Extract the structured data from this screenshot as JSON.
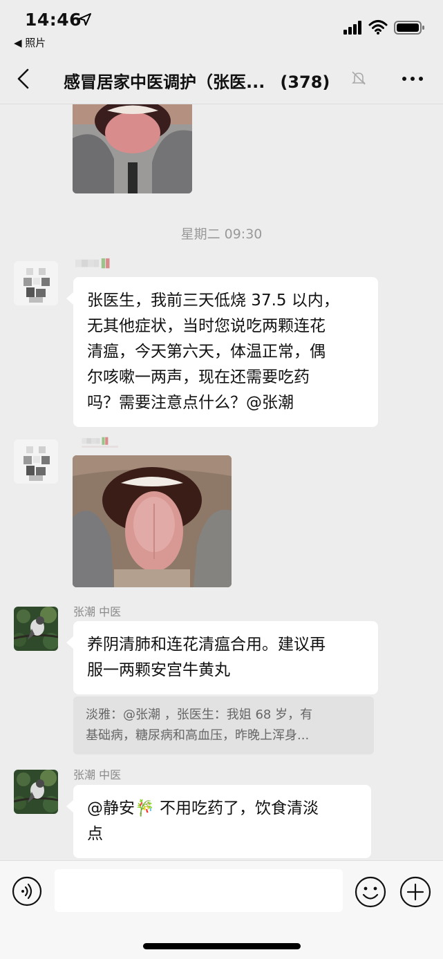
{
  "status_bar": {
    "time": "14:46",
    "back_app": "◀ 照片"
  },
  "nav": {
    "title": "感冒居家中医调护（张医...",
    "count": "(378)"
  },
  "chat": {
    "timestamp": "星期二 09:30",
    "messages": [
      {
        "type": "text",
        "text_lines": [
          "张医生，我前三天低烧 37.5 以内，",
          "无其他症状，当时您说吃两颗连花",
          "清瘟，今天第六天，体温正常，偶",
          "尔咳嗽一两声，现在还需要吃药",
          "吗？需要注意点什么？@张潮"
        ]
      },
      {
        "type": "image",
        "alt": "tongue photo"
      },
      {
        "sender": "张潮 中医",
        "type": "text",
        "text_lines": [
          "养阴清肺和连花清瘟合用。建议再",
          "服一两颗安宫牛黄丸"
        ]
      },
      {
        "type": "quote",
        "text_lines": [
          "淡雅：@张潮 ，张医生：我姐 68 岁，有",
          "基础病，糖尿病和高血压，昨晚上浑身..."
        ]
      },
      {
        "sender": "张潮 中医",
        "type": "text",
        "text_lines": [
          "@静安🎋 不用吃药了，饮食清淡",
          "点"
        ]
      }
    ]
  },
  "input": {
    "placeholder": ""
  },
  "colors": {
    "background": "#ededed",
    "bubble": "#ffffff",
    "quote_bg": "#e2e2e2",
    "timestamp": "#999999"
  },
  "icons": [
    "back-chevron-icon",
    "mute-bell-icon",
    "more-icon",
    "voice-icon",
    "emoji-icon",
    "plus-icon"
  ]
}
